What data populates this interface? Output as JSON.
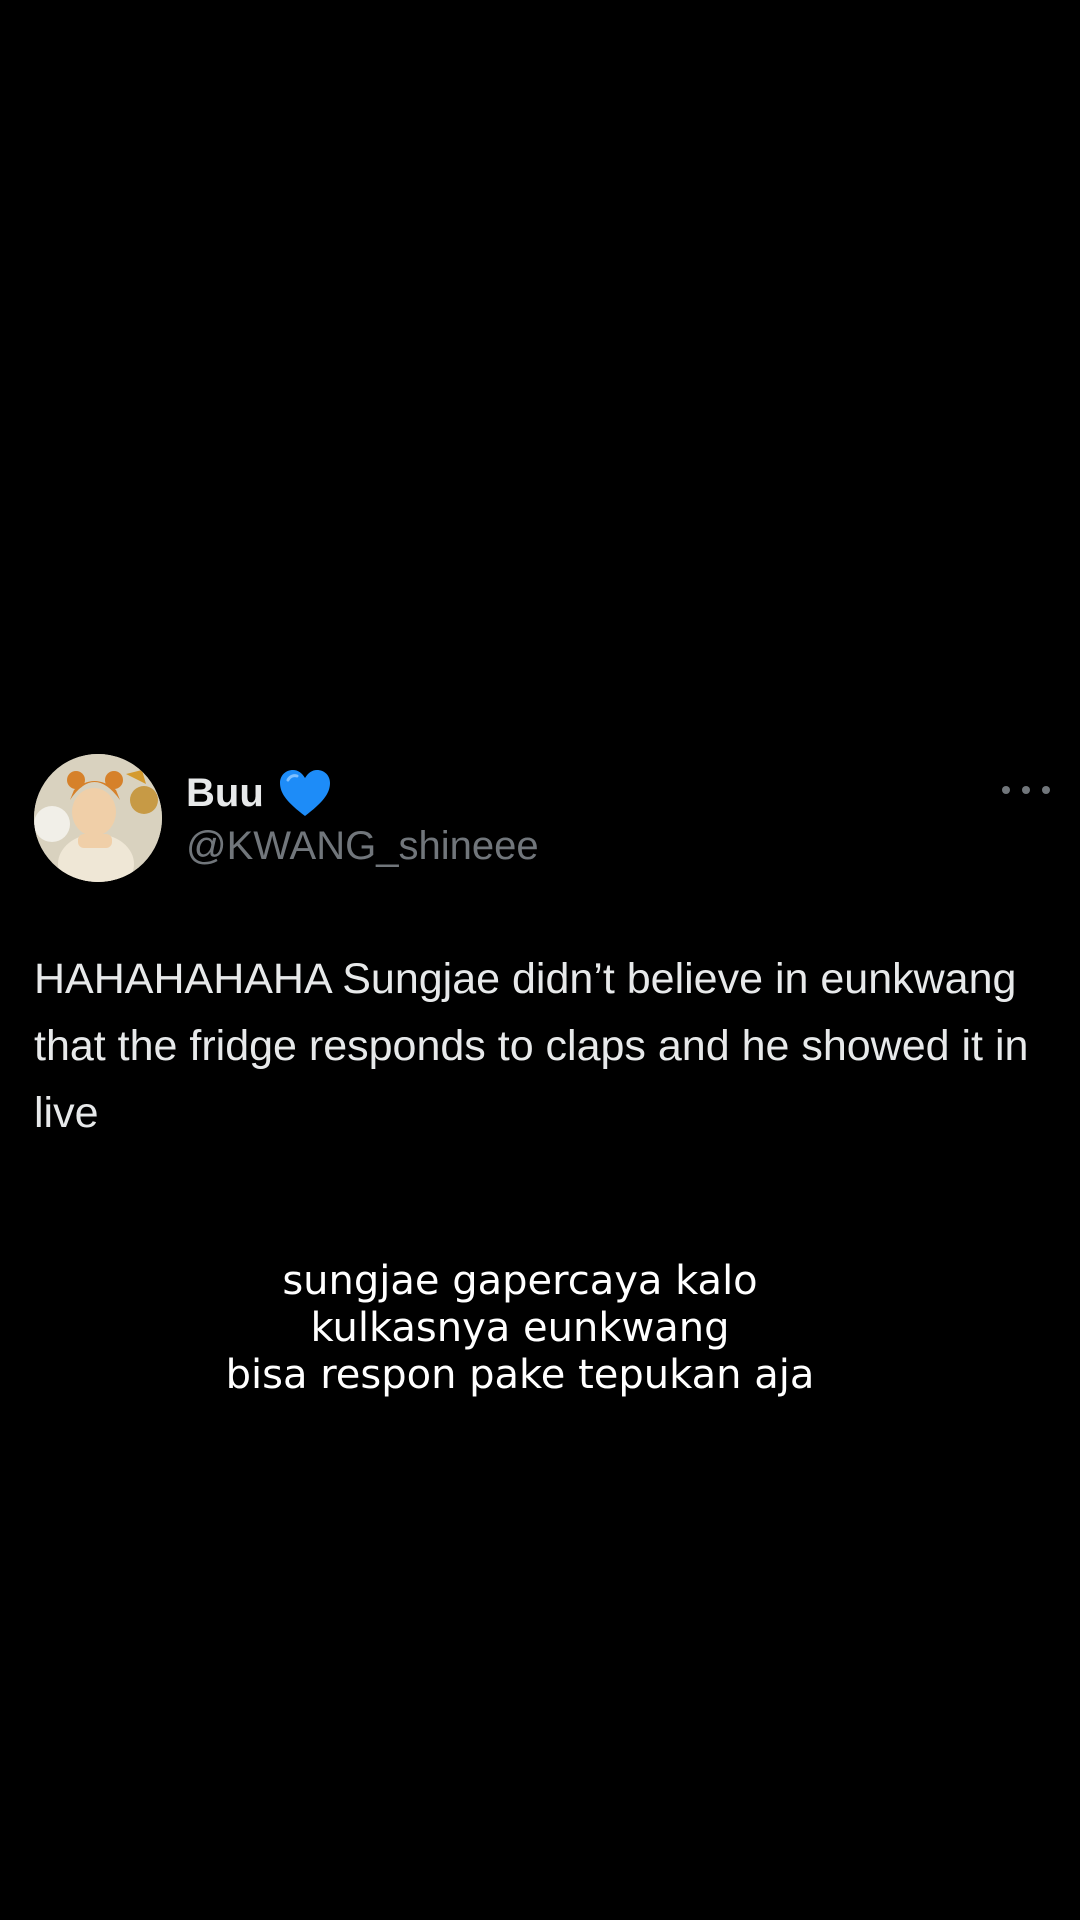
{
  "tweet": {
    "display_name": "Buu",
    "verified_emoji": "heart-icon-blue",
    "handle": "@KWANG_shineee",
    "text": "HAHAHAHAHA Sungjae didn’t believe in eunkwang that the fridge responds to claps and he showed it in live"
  },
  "caption": {
    "lines": [
      "sungjae gapercaya kalo",
      "kulkasnya eunkwang",
      "bisa respon pake tepukan aja"
    ]
  },
  "colors": {
    "background": "#000000",
    "primary_text": "#e7e9ea",
    "secondary_text": "#71767b",
    "heart": "#1d8cf8"
  }
}
